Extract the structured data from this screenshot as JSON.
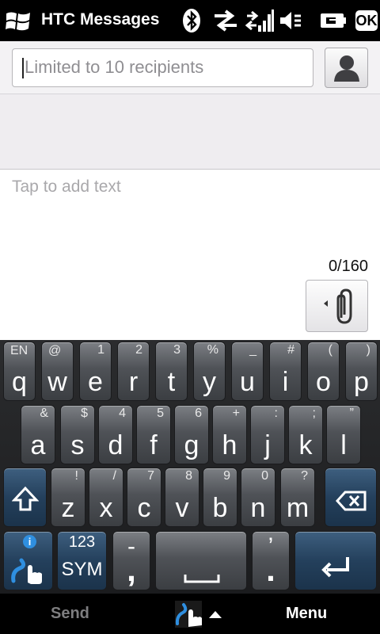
{
  "statusbar": {
    "title": "HTC Messages",
    "ok_label": "OK",
    "icons": [
      "windows-logo",
      "bluetooth-icon",
      "data-transfer-icon",
      "signal-icon",
      "volume-mute-icon",
      "battery-icon"
    ]
  },
  "recipient": {
    "placeholder": "Limited to 10 recipients"
  },
  "message": {
    "placeholder": "Tap to add text",
    "char_count": "0/160"
  },
  "keyboard": {
    "row1": [
      {
        "main": "q",
        "sub": "",
        "subl": "EN"
      },
      {
        "main": "w",
        "sub": "",
        "subl": "@"
      },
      {
        "main": "e",
        "sub": "1",
        "subl": ""
      },
      {
        "main": "r",
        "sub": "2",
        "subl": ""
      },
      {
        "main": "t",
        "sub": "3",
        "subl": ""
      },
      {
        "main": "y",
        "sub": "%",
        "subl": ""
      },
      {
        "main": "u",
        "sub": "_",
        "subl": ""
      },
      {
        "main": "i",
        "sub": "#",
        "subl": ""
      },
      {
        "main": "o",
        "sub": "(",
        "subl": ""
      },
      {
        "main": "p",
        "sub": ")",
        "subl": ""
      }
    ],
    "row2": [
      {
        "main": "a",
        "sub": "&"
      },
      {
        "main": "s",
        "sub": "$"
      },
      {
        "main": "d",
        "sub": "4"
      },
      {
        "main": "f",
        "sub": "5"
      },
      {
        "main": "g",
        "sub": "6"
      },
      {
        "main": "h",
        "sub": "+"
      },
      {
        "main": "j",
        "sub": ":"
      },
      {
        "main": "k",
        "sub": ";"
      },
      {
        "main": "l",
        "sub": "”"
      }
    ],
    "row3": [
      {
        "main": "z",
        "sub": "!"
      },
      {
        "main": "x",
        "sub": "/"
      },
      {
        "main": "c",
        "sub": "7"
      },
      {
        "main": "v",
        "sub": "8"
      },
      {
        "main": "b",
        "sub": "9"
      },
      {
        "main": "n",
        "sub": "0"
      },
      {
        "main": "m",
        "sub": "?"
      }
    ],
    "sym_top": "123",
    "sym_bottom": "SYM",
    "comma_top": "-",
    "comma_main": ",",
    "period_top": "’",
    "period_main": ".",
    "info_glyph": "i"
  },
  "softkeys": {
    "left": "Send",
    "right": "Menu"
  }
}
